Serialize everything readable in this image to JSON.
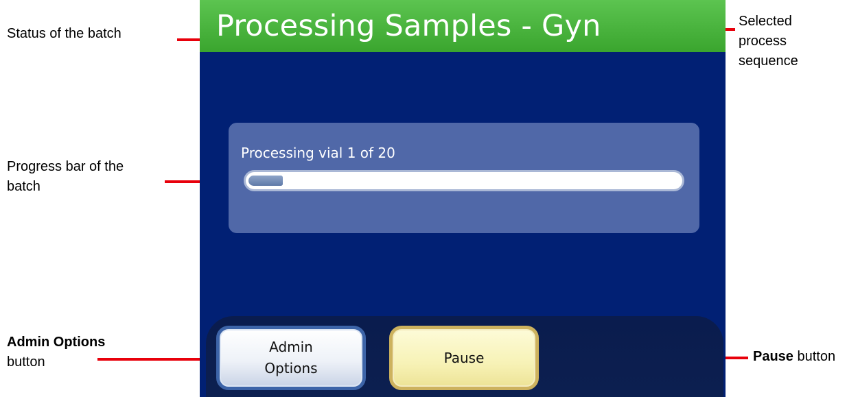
{
  "screen": {
    "title": "Processing Samples - Gyn",
    "progress": {
      "label": "Processing vial 1 of 20",
      "current": 1,
      "total": 20,
      "fraction": 0.08
    },
    "buttons": {
      "admin_line1": "Admin",
      "admin_line2": "Options",
      "pause": "Pause"
    }
  },
  "callouts": {
    "status": "Status of the batch",
    "selected_line1": "Selected",
    "selected_line2": "process",
    "selected_line3": "sequence",
    "progress_line1": "Progress bar of the",
    "progress_line2": "batch",
    "admin_bold": "Admin Options",
    "admin_suffix": "button",
    "pause_bold": "Pause",
    "pause_suffix": "button"
  },
  "colors": {
    "title_bar": "#3fae34",
    "screen_bg": "#012074",
    "panel_bg": "#5068a8",
    "leader_line": "#e8000b",
    "admin_border": "#3d64a8",
    "pause_border": "#cdb25e"
  }
}
